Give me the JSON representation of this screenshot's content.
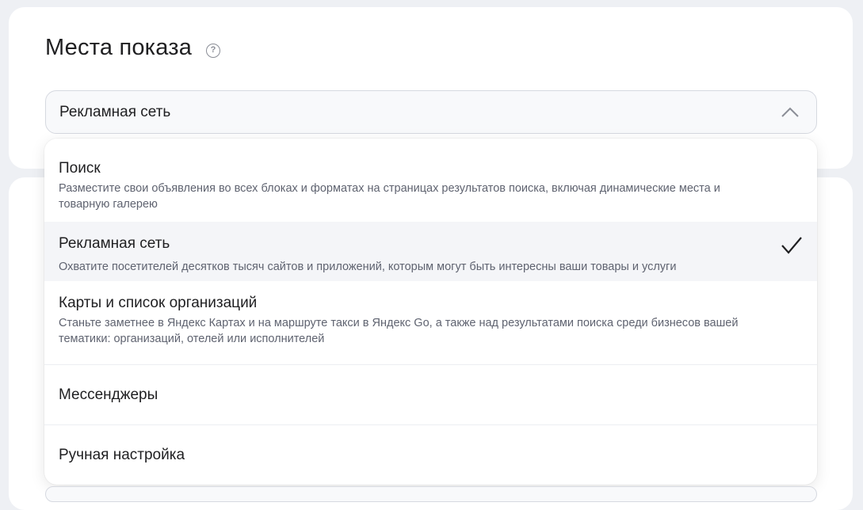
{
  "section": {
    "title": "Места показа",
    "help_icon": "?"
  },
  "select": {
    "value": "Рекламная сеть",
    "state": "open"
  },
  "options": [
    {
      "title": "Поиск",
      "description": "Разместите свои объявления во всех блоках и форматах на страницах результатов поиска, включая динамические места и товарную галерею",
      "selected": false
    },
    {
      "title": "Рекламная сеть",
      "description": "Охватите посетителей десятков тысяч сайтов и приложений, которым могут быть интересны ваши товары и услуги",
      "selected": true
    },
    {
      "title": "Карты и список организаций",
      "description": "Станьте заметнее в Яндекс Картах и на маршруте такси в Яндекс Go, а также над результатами поиска среди бизнесов вашей тематики: организаций, отелей или исполнителей",
      "selected": false
    },
    {
      "title": "Мессенджеры",
      "description": "",
      "selected": false
    },
    {
      "title": "Ручная настройка",
      "description": "",
      "selected": false
    }
  ],
  "colors": {
    "page_bg": "#eef0f4",
    "card_bg": "#ffffff",
    "selected_row_bg": "#f4f5f8",
    "text_primary": "#1f1f21",
    "text_secondary": "#5f6370"
  }
}
